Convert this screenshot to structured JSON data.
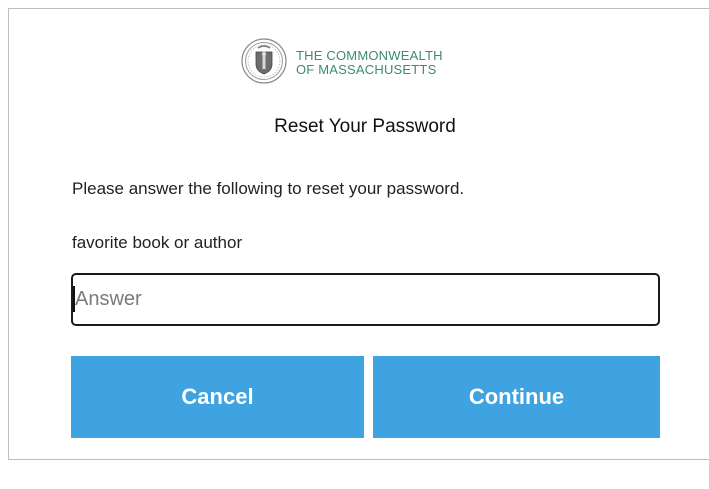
{
  "brand": {
    "seal_icon": "massachusetts-seal-icon",
    "name_line1": "THE COMMONWEALTH",
    "name_line2": "OF MASSACHUSETTS",
    "color": "#3c8a78"
  },
  "page": {
    "title": "Reset Your Password",
    "prompt": "Please answer the following to reset your password."
  },
  "security_question": {
    "label": "favorite book or author",
    "answer_value": "",
    "answer_placeholder": "Answer"
  },
  "actions": {
    "cancel_label": "Cancel",
    "continue_label": "Continue",
    "button_color": "#3fa3e1"
  }
}
